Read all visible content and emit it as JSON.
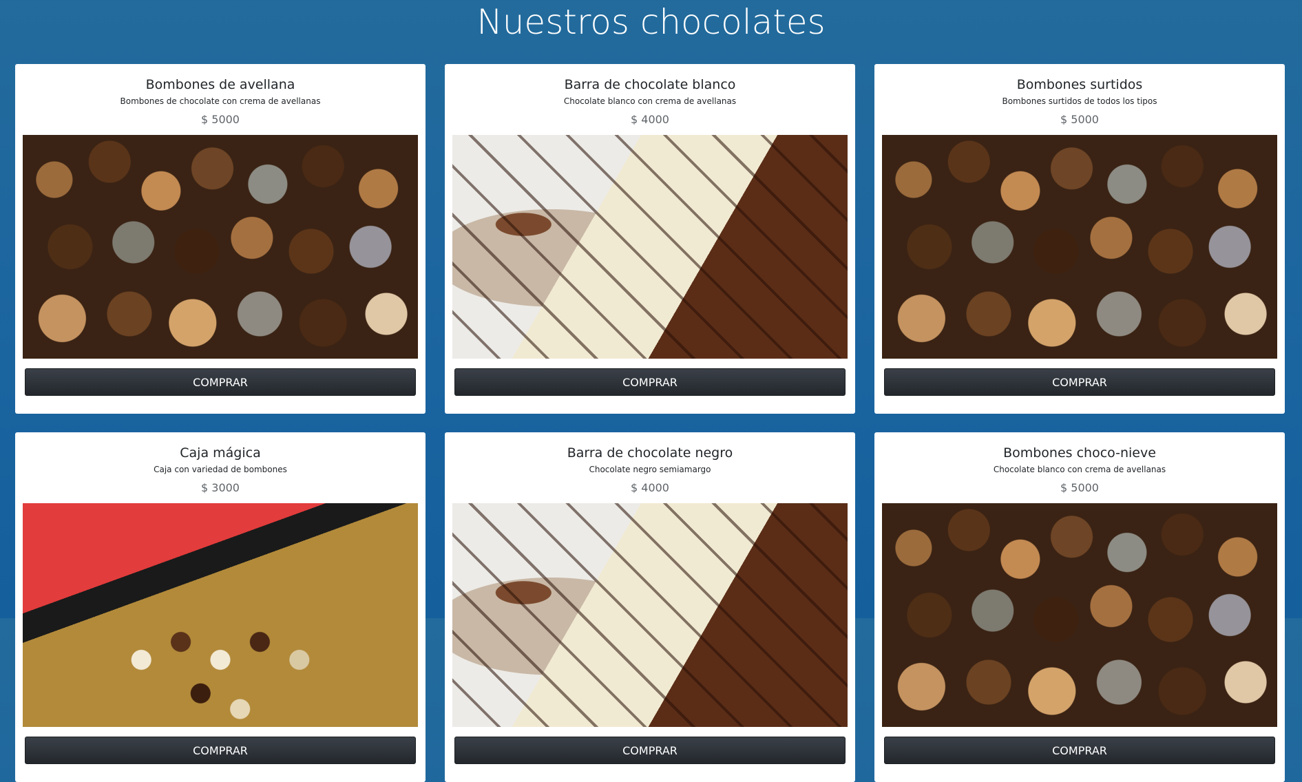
{
  "page": {
    "title": "Nuestros chocolates"
  },
  "products": [
    {
      "name": "Bombones de avellana",
      "description": "Bombones de chocolate con crema de avellanas",
      "price": "$ 5000",
      "image": "bonbons",
      "button": "COMPRAR"
    },
    {
      "name": "Barra de chocolate blanco",
      "description": "Chocolate blanco con crema de avellanas",
      "price": "$ 4000",
      "image": "chocolate-bars",
      "button": "COMPRAR"
    },
    {
      "name": "Bombones surtidos",
      "description": "Bombones surtidos de todos los tipos",
      "price": "$ 5000",
      "image": "bonbons",
      "button": "COMPRAR"
    },
    {
      "name": "Caja mágica",
      "description": "Caja con variedad de bombones",
      "price": "$ 3000",
      "image": "chocolate-box",
      "button": "COMPRAR"
    },
    {
      "name": "Barra de chocolate negro",
      "description": "Chocolate negro semiamargo",
      "price": "$ 4000",
      "image": "chocolate-bars",
      "button": "COMPRAR"
    },
    {
      "name": "Bombones choco-nieve",
      "description": "Chocolate blanco con crema de avellanas",
      "price": "$ 5000",
      "image": "bonbons",
      "button": "COMPRAR"
    }
  ]
}
